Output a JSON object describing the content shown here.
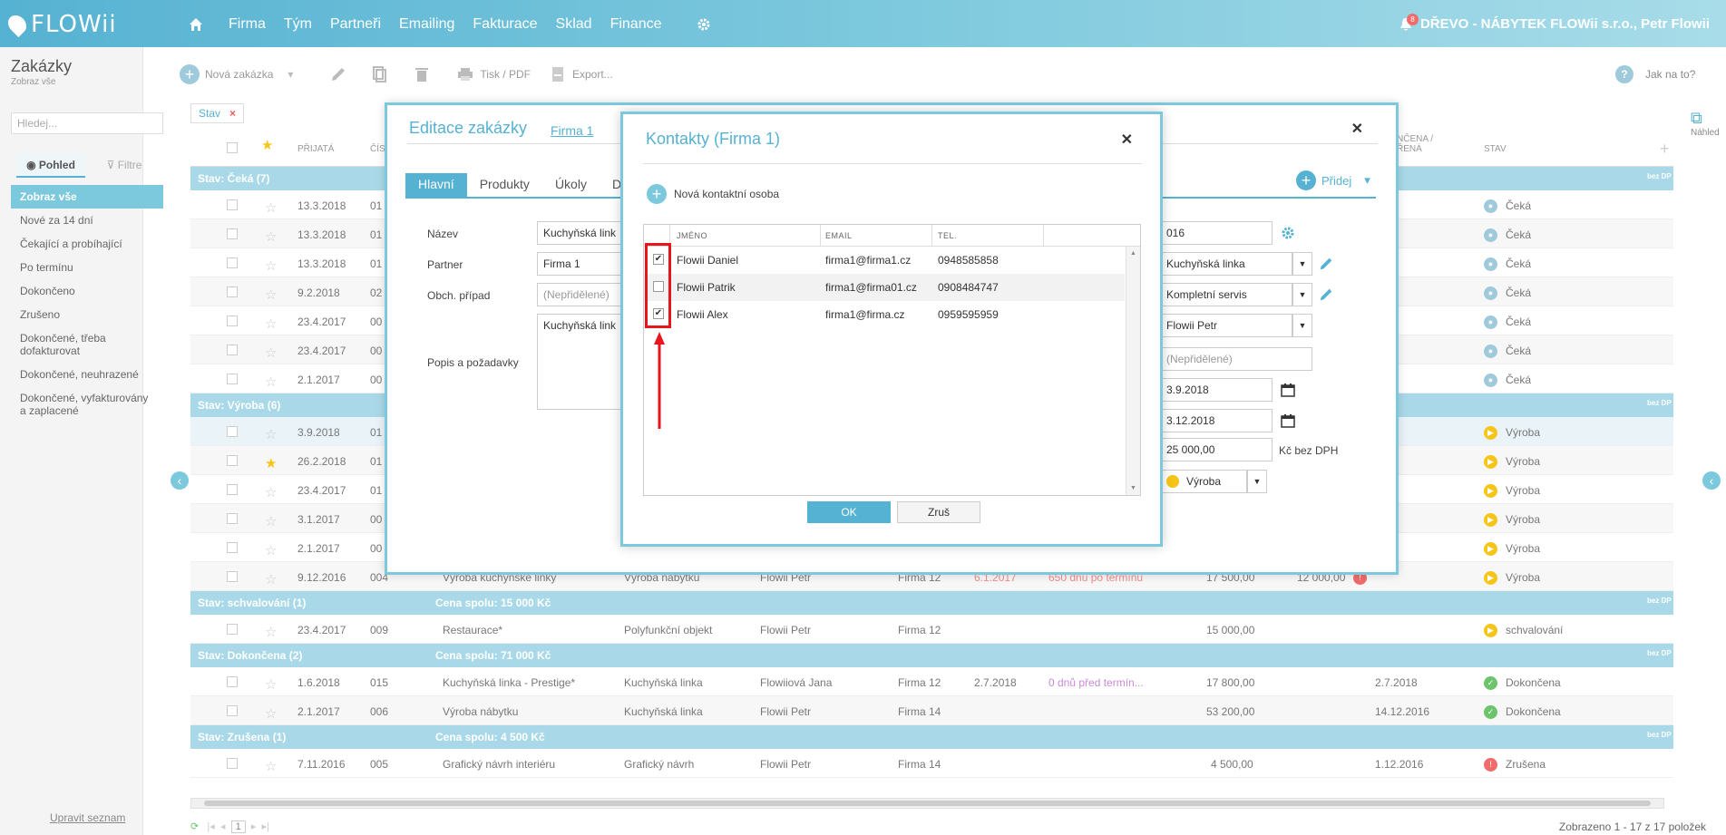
{
  "topbar": {
    "logo": "FLOWii",
    "nav": [
      "Firma",
      "Tým",
      "Partneři",
      "Emailing",
      "Fakturace",
      "Sklad",
      "Finance"
    ],
    "notifications": "8",
    "user": "DŘEVO - NÁBYTEK FLOWii s.r.o., Petr Flowii"
  },
  "sidebar": {
    "title": "Zakázky",
    "subtitle": "Zobraz vše",
    "search_placeholder": "Hledej...",
    "tab_view": "Pohled",
    "tab_filter": "Filtre",
    "items": [
      "Zobraz vše",
      "Nové za 14 dní",
      "Čekající a probíhající",
      "Po termínu",
      "Dokončeno",
      "Zrušeno",
      "Dokončené, třeba dofakturovat",
      "Dokončené, neuhrazené",
      "Dokončené, vyfakturovány a zaplacené"
    ],
    "edit_list": "Upravit seznam"
  },
  "toolbar": {
    "new_order": "Nová zakázka",
    "print": "Tisk / PDF",
    "export": "Export...",
    "help": "Jak na to?"
  },
  "grid": {
    "filter_chip": "Stav",
    "headers": {
      "received": "PŘIJATÁ",
      "number": "ČÍS",
      "completed": "NČENA / ŘENÁ",
      "status": "STAV"
    },
    "groups": [
      {
        "label": "Stav: Čeká (7)",
        "sum": "",
        "tail": "bez DP"
      },
      {
        "label": "Stav: Výroba (6)",
        "sum": "",
        "tail": "bez DP"
      },
      {
        "label": "Stav: schvalování (1)",
        "sum": "Cena spolu: 15 000 Kč",
        "tail": "bez DP"
      },
      {
        "label": "Stav: Dokončena (2)",
        "sum": "Cena spolu: 71 000 Kč",
        "tail": "bez DP"
      },
      {
        "label": "Stav: Zrušena (1)",
        "sum": "Cena spolu: 4 500 Kč",
        "tail": "bez DP"
      }
    ],
    "rows_wait": [
      {
        "date": "13.3.2018",
        "num": "01",
        "status": "Čeká"
      },
      {
        "date": "13.3.2018",
        "num": "01",
        "status": "Čeká"
      },
      {
        "date": "13.3.2018",
        "num": "01",
        "status": "Čeká"
      },
      {
        "date": "9.2.2018",
        "num": "02",
        "status": "Čeká"
      },
      {
        "date": "23.4.2017",
        "num": "00",
        "status": "Čeká"
      },
      {
        "date": "23.4.2017",
        "num": "00",
        "status": "Čeká"
      },
      {
        "date": "2.1.2017",
        "num": "00",
        "status": "Čeká"
      }
    ],
    "rows_prod": [
      {
        "date": "3.9.2018",
        "num": "01",
        "status": "Výroba"
      },
      {
        "date": "26.2.2018",
        "num": "01",
        "status": "Výroba"
      },
      {
        "date": "23.4.2017",
        "num": "01",
        "status": "Výroba"
      },
      {
        "date": "3.1.2017",
        "num": "00",
        "status": "Výroba"
      },
      {
        "date": "2.1.2017",
        "num": "00",
        "status": "Výroba"
      },
      {
        "date": "9.12.2016",
        "num": "004",
        "name": "Výroba kuchyňské linky",
        "type": "Výroba nábytku",
        "resp": "Flowii Petr",
        "firm": "Firma 12",
        "due": "6.1.2017",
        "late": "650 dnů po termínu",
        "price": "17 500,00",
        "paid": "12 000,00",
        "status": "Výroba"
      }
    ],
    "row_approval": {
      "date": "23.4.2017",
      "num": "009",
      "name": "Restaurace*",
      "type": "Polyfunkční objekt",
      "resp": "Flowii Petr",
      "firm": "Firma 12",
      "price": "15 000,00",
      "status": "schvalování"
    },
    "rows_done": [
      {
        "date": "1.6.2018",
        "num": "015",
        "name": "Kuchyňská linka - Prestige*",
        "type": "Kuchyňská linka",
        "resp": "Flowiiová Jana",
        "firm": "Firma 12",
        "due": "2.7.2018",
        "late": "0 dnů před termín...",
        "price": "17 800,00",
        "done": "2.7.2018",
        "status": "Dokončena"
      },
      {
        "date": "2.1.2017",
        "num": "006",
        "name": "Výroba nábytku",
        "type": "Kuchyňská linka",
        "resp": "Flowii Petr",
        "firm": "Firma 14",
        "due": "",
        "late": "",
        "price": "53 200,00",
        "done": "14.12.2016",
        "status": "Dokončena"
      }
    ],
    "row_cancel": {
      "date": "7.11.2016",
      "num": "005",
      "name": "Grafický návrh interiéru",
      "type": "Grafický návrh",
      "resp": "Flowii Petr",
      "firm": "Firma 14",
      "price": "4 500,00",
      "done": "1.12.2016",
      "status": "Zrušena"
    },
    "footer_page": "1",
    "footer_count": "Zobrazeno 1 - 17 z 17 položek",
    "preview": "Náhled"
  },
  "edit_dialog": {
    "title": "Editace zakázky",
    "link": "Firma 1",
    "tabs": [
      "Hlavní",
      "Produkty",
      "Úkoly",
      "D"
    ],
    "add": "Přidej",
    "labels": {
      "name": "Název",
      "partner": "Partner",
      "case": "Obch. případ",
      "desc": "Popis a požadavky"
    },
    "values": {
      "name": "Kuchyňská link",
      "partner": "Firma 1",
      "case_placeholder": "(Nepřidělené)",
      "desc": "Kuchyňská link",
      "number": "016",
      "type": "Kuchyňská linka",
      "service": "Kompletní servis",
      "responsible": "Flowii Petr",
      "unassigned": "(Nepřidělené)",
      "date_from": "3.9.2018",
      "date_to": "3.12.2018",
      "price": "25 000,00",
      "currency": "Kč bez DPH",
      "status": "Výroba"
    }
  },
  "contacts_dialog": {
    "title": "Kontakty (Firma 1)",
    "new_contact": "Nová kontaktní osoba",
    "headers": {
      "name": "JMÉNO",
      "email": "EMAIL",
      "phone": "TEL."
    },
    "rows": [
      {
        "checked": true,
        "name": "Flowii Daniel",
        "email": "firma1@firma1.cz",
        "phone": "0948585858"
      },
      {
        "checked": false,
        "name": "Flowii Patrik",
        "email": "firma1@firma01.cz",
        "phone": "0908484747"
      },
      {
        "checked": true,
        "name": "Flowii Alex",
        "email": "firma1@firma.cz",
        "phone": "0959595959"
      }
    ],
    "ok": "OK",
    "cancel": "Zruš"
  },
  "colors": {
    "accent": "#56b2d2",
    "group": "#a9d9e8",
    "highlight": "#e8161c",
    "wait": "#9fcadb",
    "prod": "#f5c518",
    "done": "#6cc46c",
    "cancel": "#f06b6b"
  }
}
